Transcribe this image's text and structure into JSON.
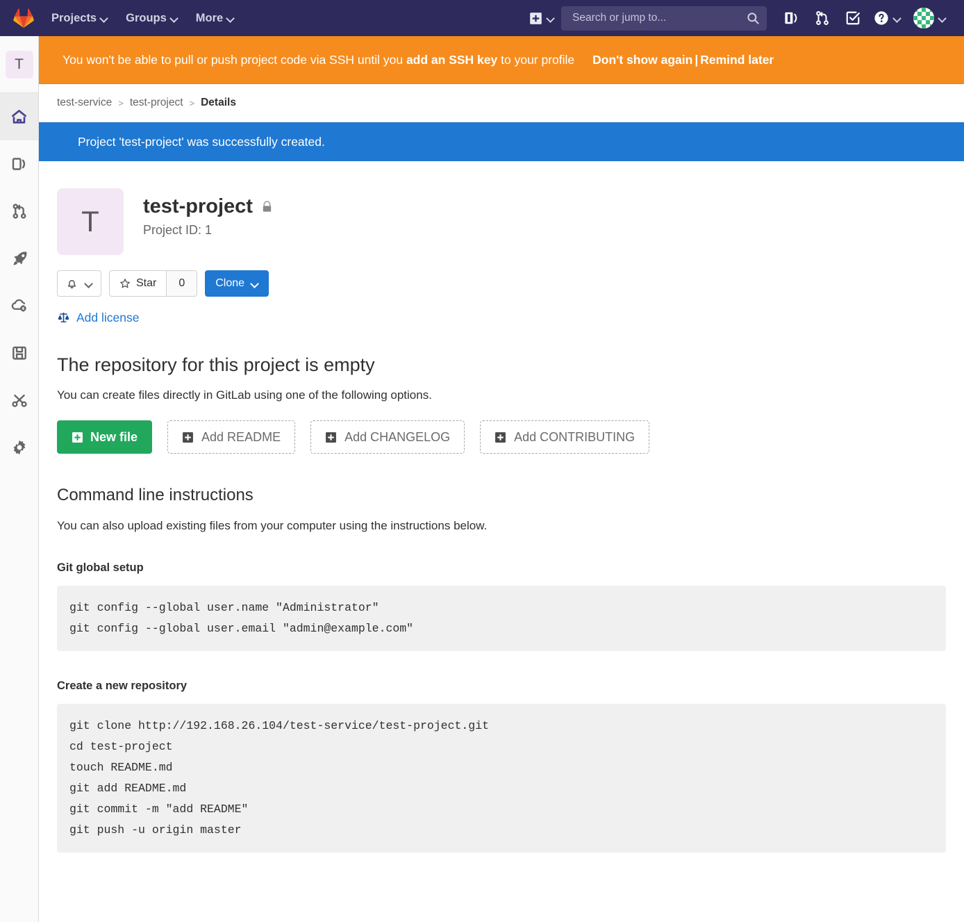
{
  "navbar": {
    "logo_icon": "gitlab-logo-icon",
    "links": [
      {
        "label": "Projects",
        "icon": "chevron-down-icon"
      },
      {
        "label": "Groups",
        "icon": "chevron-down-icon"
      },
      {
        "label": "More",
        "icon": "chevron-down-icon"
      }
    ],
    "create_icon": "plus-square-icon",
    "search": {
      "placeholder": "Search or jump to...",
      "value": "",
      "icon": "search-icon"
    },
    "icons": [
      {
        "name": "issues-icon"
      },
      {
        "name": "merge-requests-icon"
      },
      {
        "name": "todos-icon"
      },
      {
        "name": "help-icon"
      }
    ],
    "avatar_icon": "user-avatar-identicon"
  },
  "sidebar": {
    "avatar_letter": "T",
    "items": [
      {
        "name": "project-overview",
        "icon": "home-icon",
        "active": true
      },
      {
        "name": "repository",
        "icon": "repository-icon",
        "active": false
      },
      {
        "name": "merge-requests",
        "icon": "merge-request-icon",
        "active": false
      },
      {
        "name": "ci-cd",
        "icon": "rocket-icon",
        "active": false
      },
      {
        "name": "operations",
        "icon": "cloud-gear-icon",
        "active": false
      },
      {
        "name": "packages",
        "icon": "package-icon",
        "active": false
      },
      {
        "name": "snippets",
        "icon": "scissors-icon",
        "active": false
      },
      {
        "name": "settings",
        "icon": "gear-icon",
        "active": false
      }
    ]
  },
  "ssh_banner": {
    "text_before": "You won't be able to pull or push project code via SSH until you ",
    "link_text": "add an SSH key",
    "text_after": " to your profile",
    "dont_show": "Don't show again",
    "separator": "|",
    "remind_later": "Remind later",
    "background": "#f68c1e"
  },
  "breadcrumb": {
    "items": [
      {
        "label": "test-service",
        "current": false
      },
      {
        "label": "test-project",
        "current": false
      },
      {
        "label": "Details",
        "current": true
      }
    ],
    "separator": ">"
  },
  "alert": {
    "message": "Project 'test-project' was successfully created.",
    "background": "#1f78d1"
  },
  "project": {
    "avatar_letter": "T",
    "name": "test-project",
    "visibility_icon": "lock-icon",
    "id_label": "Project ID: 1",
    "notification_icon": "bell-icon",
    "star_label": "Star",
    "star_icon": "star-icon",
    "star_count": "0",
    "clone_label": "Clone",
    "add_license_label": "Add license",
    "add_license_icon": "scale-balance-icon"
  },
  "empty_repo": {
    "heading": "The repository for this project is empty",
    "subtext": "You can create files directly in GitLab using one of the following options.",
    "buttons": [
      {
        "label": "New file",
        "icon": "plus-square-icon",
        "style": "primary-green"
      },
      {
        "label": "Add README",
        "icon": "plus-square-icon",
        "style": "dashed"
      },
      {
        "label": "Add CHANGELOG",
        "icon": "plus-square-icon",
        "style": "dashed"
      },
      {
        "label": "Add CONTRIBUTING",
        "icon": "plus-square-icon",
        "style": "dashed"
      }
    ]
  },
  "command_line": {
    "heading": "Command line instructions",
    "subtext": "You can also upload existing files from your computer using the instructions below.",
    "sections": [
      {
        "title": "Git global setup",
        "code": "git config --global user.name \"Administrator\"\ngit config --global user.email \"admin@example.com\""
      },
      {
        "title": "Create a new repository",
        "code": "git clone http://192.168.26.104/test-service/test-project.git\ncd test-project\ntouch README.md\ngit add README.md\ngit commit -m \"add README\"\ngit push -u origin master"
      }
    ]
  },
  "colors": {
    "navbar": "#2e2a5b",
    "warning": "#f68c1e",
    "info": "#1f78d1",
    "success_green": "#21a85c",
    "link_blue": "#1f78d1"
  }
}
